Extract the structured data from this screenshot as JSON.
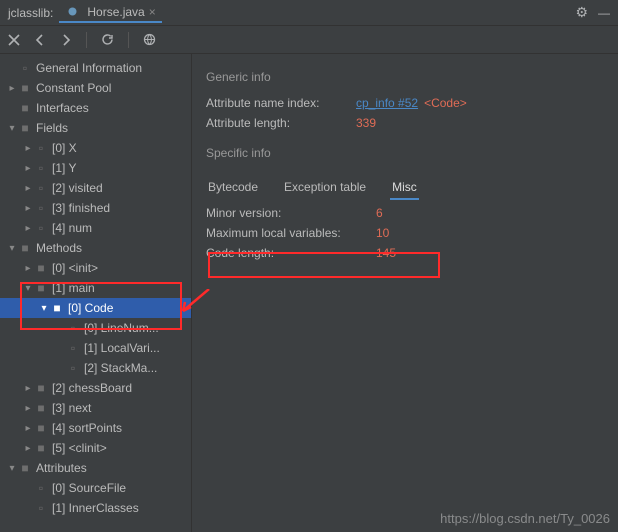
{
  "title": {
    "library": "jclasslib:",
    "file": "Horse.java"
  },
  "icons": {
    "gear": "⚙",
    "close_panel": "—",
    "tab_close": "×"
  },
  "tree": {
    "general_info": "General Information",
    "constant_pool": "Constant Pool",
    "interfaces": "Interfaces",
    "fields": "Fields",
    "field_items": [
      "[0] X",
      "[1] Y",
      "[2] visited",
      "[3] finished",
      "[4] num"
    ],
    "methods": "Methods",
    "method_init": "[0] <init>",
    "method_main": "[1] main",
    "code": "[0] Code",
    "code_children": [
      "[0] LineNum...",
      "[1] LocalVari...",
      "[2] StackMa..."
    ],
    "method_chess": "[2] chessBoard",
    "method_next": "[3] next",
    "method_sort": "[4] sortPoints",
    "method_clinit": "[5] <clinit>",
    "attributes": "Attributes",
    "attr_items": [
      "[0] SourceFile",
      "[1] InnerClasses"
    ]
  },
  "panel": {
    "generic_info": "Generic info",
    "attr_name_index_label": "Attribute name index:",
    "attr_name_link": "cp_info #52",
    "attr_name_type": "<Code>",
    "attr_length_label": "Attribute length:",
    "attr_length_value": "339",
    "specific_info": "Specific info",
    "tabs": {
      "bytecode": "Bytecode",
      "exception": "Exception table",
      "misc": "Misc"
    },
    "minor_version_label": "Minor version:",
    "minor_version_value": "6",
    "max_locals_label": "Maximum local variables:",
    "max_locals_value": "10",
    "code_length_label": "Code length:",
    "code_length_value": "145"
  },
  "watermark": "https://blog.csdn.net/Ty_0026"
}
